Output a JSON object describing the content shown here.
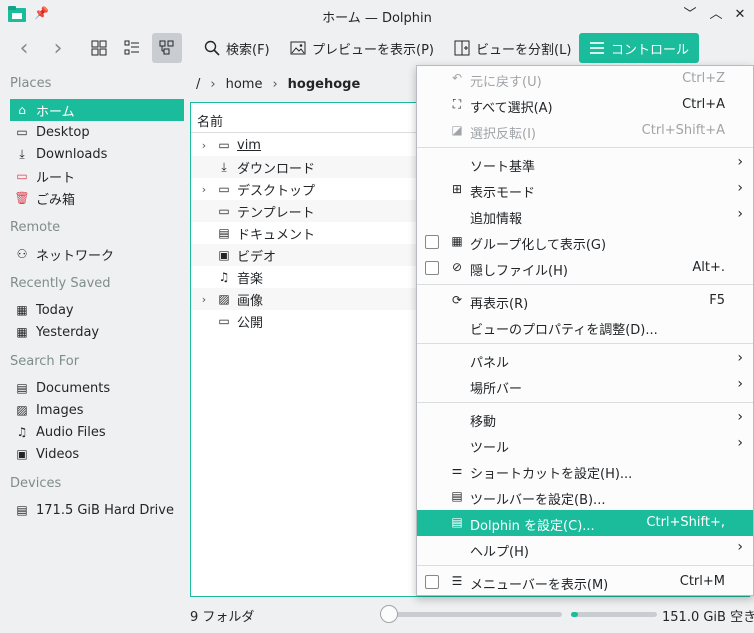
{
  "window": {
    "title": "ホーム — Dolphin",
    "pin_glyph": "📌",
    "minimize_glyph": "﹀",
    "maximize_glyph": "︿",
    "close_glyph": "✕"
  },
  "toolbar": {
    "back_glyph": "‹",
    "forward_glyph": "›",
    "search_label": "検索(F)",
    "preview_label": "プレビューを表示(P)",
    "split_label": "ビューを分割(L)",
    "control_label": "コントロール"
  },
  "sidebar": {
    "places_heading": "Places",
    "places": [
      {
        "label": "ホーム",
        "icon": "⌂"
      },
      {
        "label": "Desktop",
        "icon": "▭"
      },
      {
        "label": "Downloads",
        "icon": "⤓"
      },
      {
        "label": "ルート",
        "icon": "▭"
      },
      {
        "label": "ごみ箱",
        "icon": "🗑"
      }
    ],
    "remote_heading": "Remote",
    "remote": [
      {
        "label": "ネットワーク",
        "icon": "⚇"
      }
    ],
    "recent_heading": "Recently Saved",
    "recent": [
      {
        "label": "Today",
        "icon": "▦"
      },
      {
        "label": "Yesterday",
        "icon": "▦"
      }
    ],
    "search_heading": "Search For",
    "search": [
      {
        "label": "Documents",
        "icon": "▤"
      },
      {
        "label": "Images",
        "icon": "▨"
      },
      {
        "label": "Audio Files",
        "icon": "♫"
      },
      {
        "label": "Videos",
        "icon": "▣"
      }
    ],
    "devices_heading": "Devices",
    "devices": [
      {
        "label": "171.5 GiB Hard Drive",
        "icon": "▤"
      }
    ]
  },
  "breadcrumb": {
    "root": "/",
    "sep": "›",
    "home": "home",
    "current": "hogehoge"
  },
  "view": {
    "column_name": "名前",
    "rows": [
      {
        "label": "vim",
        "expandable": true,
        "icon": "▭",
        "expander_glyph": "›"
      },
      {
        "label": "ダウンロード",
        "expandable": false,
        "icon": "⤓"
      },
      {
        "label": "デスクトップ",
        "expandable": true,
        "icon": "▭",
        "expander_glyph": "›"
      },
      {
        "label": "テンプレート",
        "expandable": false,
        "icon": "▭"
      },
      {
        "label": "ドキュメント",
        "expandable": false,
        "icon": "▤"
      },
      {
        "label": "ビデオ",
        "expandable": false,
        "icon": "▣"
      },
      {
        "label": "音楽",
        "expandable": false,
        "icon": "♫"
      },
      {
        "label": "画像",
        "expandable": true,
        "icon": "▨",
        "expander_glyph": "›"
      },
      {
        "label": "公開",
        "expandable": false,
        "icon": "▭"
      }
    ]
  },
  "status": {
    "folder_count": "9 フォルダ",
    "free_space": "151.0 GiB 空き",
    "used_fraction": 0.08,
    "zoom_fraction": 0.0
  },
  "menu": {
    "items": [
      {
        "label": "元に戻す(U)",
        "shortcut": "Ctrl+Z",
        "icon": "↶",
        "disabled": true
      },
      {
        "label": "すべて選択(A)",
        "shortcut": "Ctrl+A",
        "icon": "⛶"
      },
      {
        "label": "選択反転(I)",
        "shortcut": "Ctrl+Shift+A",
        "icon": "◪",
        "disabled": true
      },
      {
        "label": "ソート基準",
        "submenu": true
      },
      {
        "label": "表示モード",
        "submenu": true,
        "icon": "⊞"
      },
      {
        "label": "追加情報",
        "submenu": true
      },
      {
        "label": "グループ化して表示(G)",
        "checkbox": true,
        "icon": "▦"
      },
      {
        "label": "隠しファイル(H)",
        "shortcut": "Alt+.",
        "checkbox": true,
        "icon": "⊘"
      },
      {
        "label": "再表示(R)",
        "shortcut": "F5",
        "icon": "⟳"
      },
      {
        "label": "ビューのプロパティを調整(D)..."
      },
      {
        "label": "パネル",
        "submenu": true
      },
      {
        "label": "場所バー",
        "submenu": true
      },
      {
        "label": "移動",
        "submenu": true
      },
      {
        "label": "ツール",
        "submenu": true
      },
      {
        "label": "ショートカットを設定(H)...",
        "icon": "⚌"
      },
      {
        "label": "ツールバーを設定(B)...",
        "icon": "▤"
      },
      {
        "label": "Dolphin を設定(C)...",
        "shortcut": "Ctrl+Shift+,",
        "icon": "▤",
        "highlighted": true
      },
      {
        "label": "ヘルプ(H)",
        "submenu": true
      },
      {
        "label": "メニューバーを表示(M)",
        "shortcut": "Ctrl+M",
        "checkbox": true,
        "icon": "☰"
      }
    ],
    "submenu_arrow": "›"
  },
  "colors": {
    "accent": "#1abc9c",
    "danger": "#da4453"
  }
}
